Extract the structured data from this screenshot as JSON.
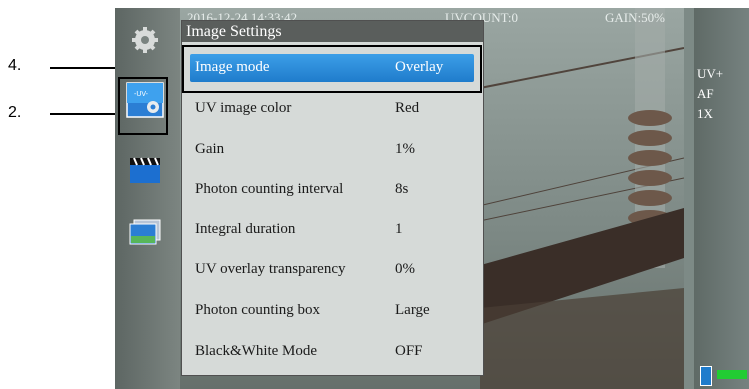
{
  "top_status": {
    "date_partial": "2016-12-24 14:33:42",
    "uv_count": "UVCOUNT:0",
    "gain": "GAIN:50%"
  },
  "right_labels": [
    "UV+",
    "AF",
    "1X"
  ],
  "sidebar": {
    "items": [
      {
        "name": "settings-gear-icon"
      },
      {
        "name": "image-settings-icon",
        "selected": true
      },
      {
        "name": "video-clapper-icon"
      },
      {
        "name": "image-gallery-icon"
      }
    ]
  },
  "menu": {
    "title": "Image Settings",
    "rows": [
      {
        "label": "Image mode",
        "value": "Overlay",
        "selected": true
      },
      {
        "label": "UV image color",
        "value": "Red"
      },
      {
        "label": "Gain",
        "value": "1%"
      },
      {
        "label": "Photon counting interval",
        "value": "8s"
      },
      {
        "label": "Integral duration",
        "value": "1"
      },
      {
        "label": "UV overlay transparency",
        "value": "0%"
      },
      {
        "label": "Photon counting box",
        "value": "Large"
      },
      {
        "label": "Black&White Mode",
        "value": "OFF"
      }
    ]
  },
  "callouts": {
    "c4": "4.",
    "c2": "2."
  },
  "colors": {
    "selection": "#1f7ccc",
    "battery": "#22cc33"
  }
}
